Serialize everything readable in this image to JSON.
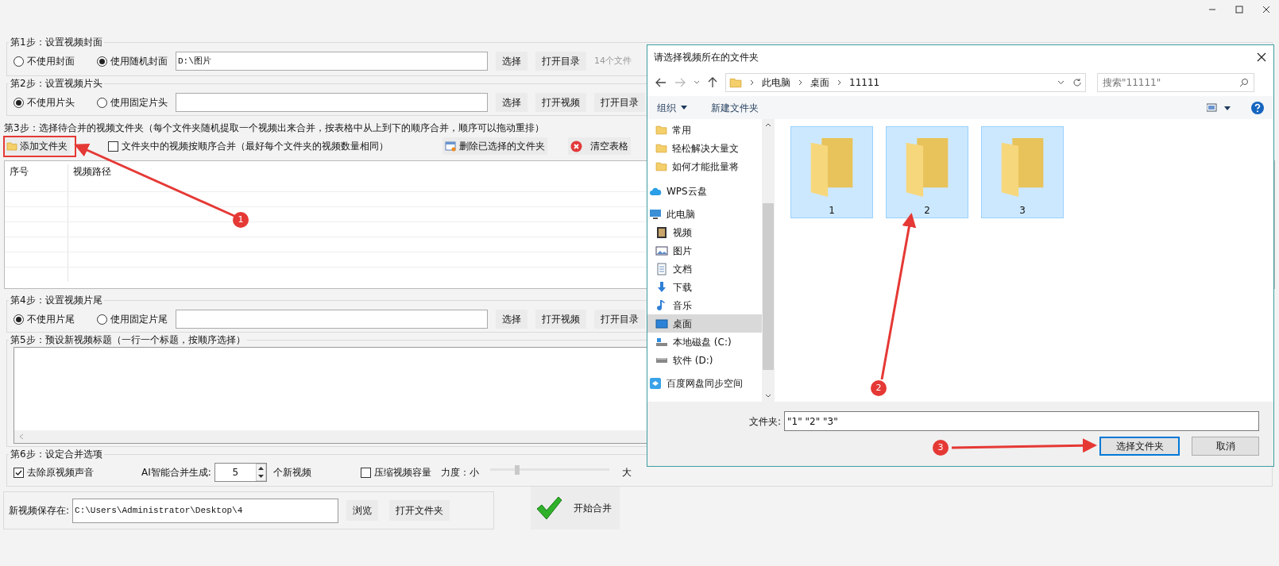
{
  "step1": {
    "title": "第1步：设置视频封面",
    "options": [
      {
        "label": "不使用封面",
        "selected": false
      },
      {
        "label": "使用随机封面",
        "selected": true
      }
    ],
    "path": "D:\\图片",
    "buttons": [
      "选择",
      "打开目录"
    ],
    "note": "14个文件"
  },
  "step2": {
    "title": "第2步：设置视频片头",
    "options": [
      {
        "label": "不使用片头",
        "selected": true
      },
      {
        "label": "使用固定片头",
        "selected": false
      }
    ],
    "buttons": [
      "选择",
      "打开视频",
      "打开目录"
    ]
  },
  "step3": {
    "title": "第3步：选择待合并的视频文件夹（每个文件夹随机提取一个视频出来合并，按表格中从上到下的顺序合并，顺序可以拖动重排）",
    "add_button": "添加文件夹",
    "sequential": {
      "label": "文件夹中的视频按顺序合并（最好每个文件夹的视频数量相同）",
      "checked": false
    },
    "delete_button": "删除已选择的文件夹",
    "clear_button": "清空表格",
    "table": {
      "columns": [
        "序号",
        "视频路径"
      ]
    }
  },
  "step4": {
    "title": "第4步：设置视频片尾",
    "options": [
      {
        "label": "不使用片尾",
        "selected": true
      },
      {
        "label": "使用固定片尾",
        "selected": false
      }
    ],
    "buttons": [
      "选择",
      "打开视频",
      "打开目录"
    ]
  },
  "step5": {
    "title": "第5步：预设新视频标题（一行一个标题，按顺序选择）"
  },
  "step6": {
    "title": "第6步：设定合并选项",
    "mute": {
      "label": "去除原视频声音",
      "checked": true
    },
    "ai_label": "AI智能合并生成:",
    "count": "5",
    "count_suffix": "个新视频",
    "compress": {
      "label": "压缩视频容量",
      "checked": false
    },
    "strength_label": "力度：小",
    "strength": {
      "level": 0.23
    },
    "strength_max": "大"
  },
  "save": {
    "label": "新视频保存在:",
    "path": "C:\\Users\\Administrator\\Desktop\\4",
    "buttons": [
      "浏览",
      "打开文件夹"
    ]
  },
  "start_button": "开始合并",
  "dialog": {
    "title": "请选择视频所在的文件夹",
    "breadcrumb": [
      "此电脑",
      "桌面",
      "11111"
    ],
    "search_placeholder": "搜索\"11111\"",
    "toolbar": {
      "organize": "组织",
      "new_folder": "新建文件夹"
    },
    "nav": {
      "quick_items": [
        "常用",
        "轻松解决大量文",
        "如何才能批量将"
      ],
      "tree": [
        {
          "label": "WPS云盘",
          "selected": false
        },
        {
          "label": "此电脑",
          "selected": false,
          "children": [
            {
              "label": "视频",
              "selected": false
            },
            {
              "label": "图片",
              "selected": false
            },
            {
              "label": "文档",
              "selected": false
            },
            {
              "label": "下载",
              "selected": false
            },
            {
              "label": "音乐",
              "selected": false
            },
            {
              "label": "桌面",
              "selected": true
            },
            {
              "label": "本地磁盘 (C:)",
              "selected": false
            },
            {
              "label": "软件 (D:)",
              "selected": false
            }
          ]
        },
        {
          "label": "百度网盘同步空间",
          "selected": false
        }
      ]
    },
    "folders": [
      {
        "name": "1",
        "selected": true
      },
      {
        "name": "2",
        "selected": true
      },
      {
        "name": "3",
        "selected": true
      }
    ],
    "folder_label": "文件夹:",
    "folder_value": "\"1\" \"2\" \"3\"",
    "buttons": [
      "选择文件夹",
      "取消"
    ]
  },
  "annotations": [
    {
      "number": "1"
    },
    {
      "number": "2"
    },
    {
      "number": "3"
    }
  ]
}
